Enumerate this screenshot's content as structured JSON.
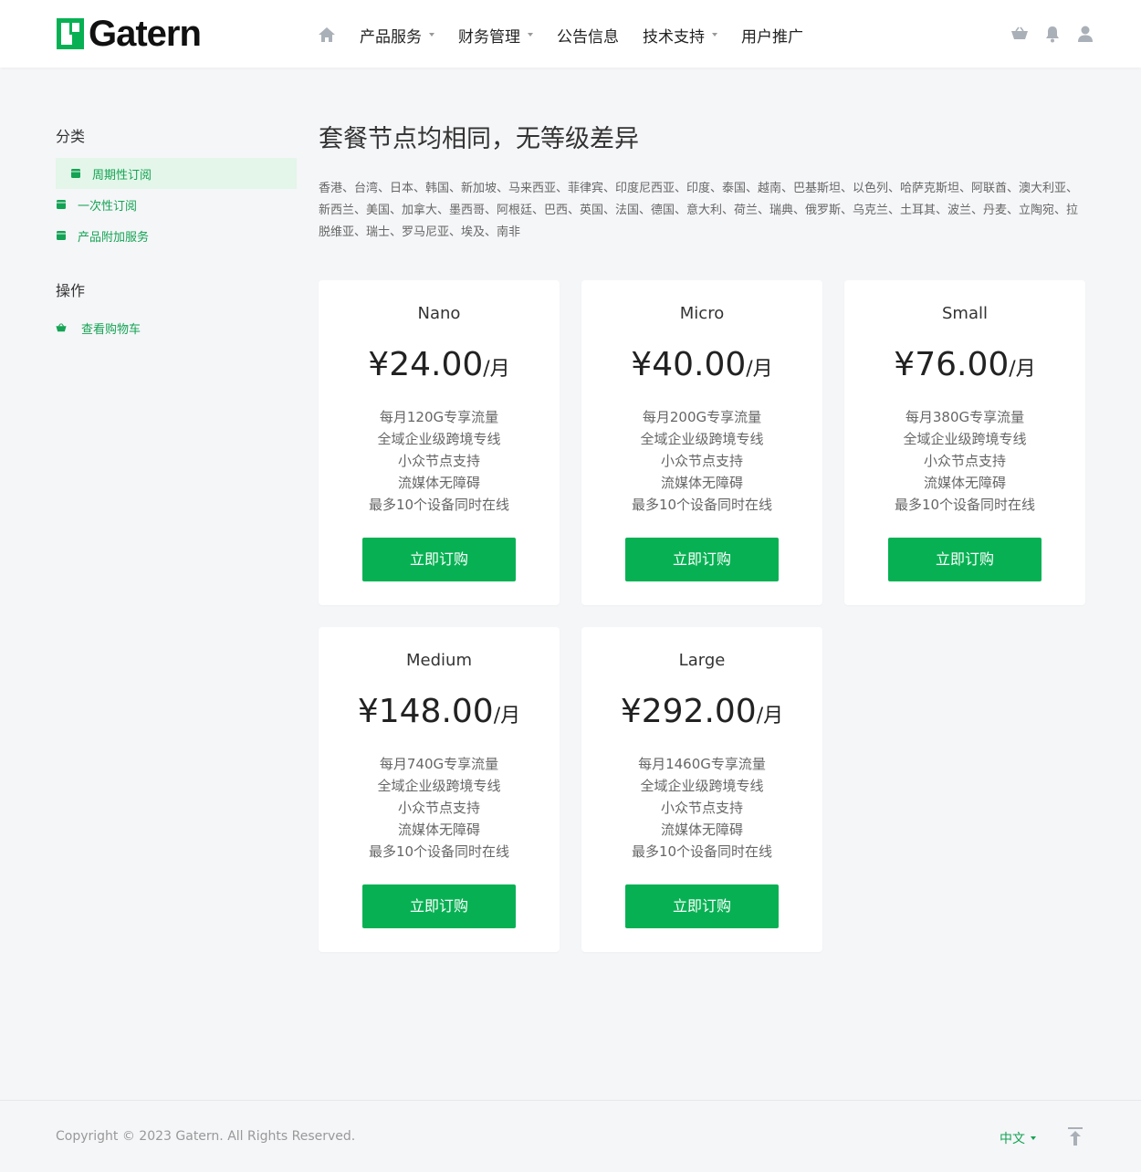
{
  "header": {
    "logo_text": "Gatern",
    "nav": [
      {
        "label": "产品服务",
        "dropdown": true
      },
      {
        "label": "财务管理",
        "dropdown": true
      },
      {
        "label": "公告信息",
        "dropdown": false
      },
      {
        "label": "技术支持",
        "dropdown": true
      },
      {
        "label": "用户推广",
        "dropdown": false
      }
    ],
    "icons": [
      "home-icon",
      "cart-icon",
      "bell-icon",
      "user-icon"
    ]
  },
  "sidebar": {
    "category_title": "分类",
    "categories": [
      {
        "label": "周期性订阅",
        "active": true
      },
      {
        "label": "一次性订阅",
        "active": false
      },
      {
        "label": "产品附加服务",
        "active": false
      }
    ],
    "actions_title": "操作",
    "actions": [
      {
        "label": "查看购物车"
      }
    ]
  },
  "main": {
    "title": "套餐节点均相同，无等级差异",
    "regions": "香港、台湾、日本、韩国、新加坡、马来西亚、菲律宾、印度尼西亚、印度、泰国、越南、巴基斯坦、以色列、哈萨克斯坦、阿联酋、澳大利亚、新西兰、美国、加拿大、墨西哥、阿根廷、巴西、英国、法国、德国、意大利、荷兰、瑞典、俄罗斯、乌克兰、土耳其、波兰、丹麦、立陶宛、拉脱维亚、瑞士、罗马尼亚、埃及、南非",
    "plans": [
      {
        "name": "Nano",
        "price": "¥24.00",
        "unit": "/月",
        "features": [
          "每月120G专享流量",
          "全域企业级跨境专线",
          "小众节点支持",
          "流媒体无障碍",
          "最多10个设备同时在线"
        ],
        "button": "立即订购"
      },
      {
        "name": "Micro",
        "price": "¥40.00",
        "unit": "/月",
        "features": [
          "每月200G专享流量",
          "全域企业级跨境专线",
          "小众节点支持",
          "流媒体无障碍",
          "最多10个设备同时在线"
        ],
        "button": "立即订购"
      },
      {
        "name": "Small",
        "price": "¥76.00",
        "unit": "/月",
        "features": [
          "每月380G专享流量",
          "全域企业级跨境专线",
          "小众节点支持",
          "流媒体无障碍",
          "最多10个设备同时在线"
        ],
        "button": "立即订购"
      },
      {
        "name": "Medium",
        "price": "¥148.00",
        "unit": "/月",
        "features": [
          "每月740G专享流量",
          "全域企业级跨境专线",
          "小众节点支持",
          "流媒体无障碍",
          "最多10个设备同时在线"
        ],
        "button": "立即订购"
      },
      {
        "name": "Large",
        "price": "¥292.00",
        "unit": "/月",
        "features": [
          "每月1460G专享流量",
          "全域企业级跨境专线",
          "小众节点支持",
          "流媒体无障碍",
          "最多10个设备同时在线"
        ],
        "button": "立即订购"
      }
    ]
  },
  "footer": {
    "copyright": "Copyright © 2023 Gatern. All Rights Reserved.",
    "language": "中文"
  },
  "colors": {
    "brand_green": "#07b153",
    "link_green": "#14a354",
    "active_bg": "#e3f6e9"
  }
}
